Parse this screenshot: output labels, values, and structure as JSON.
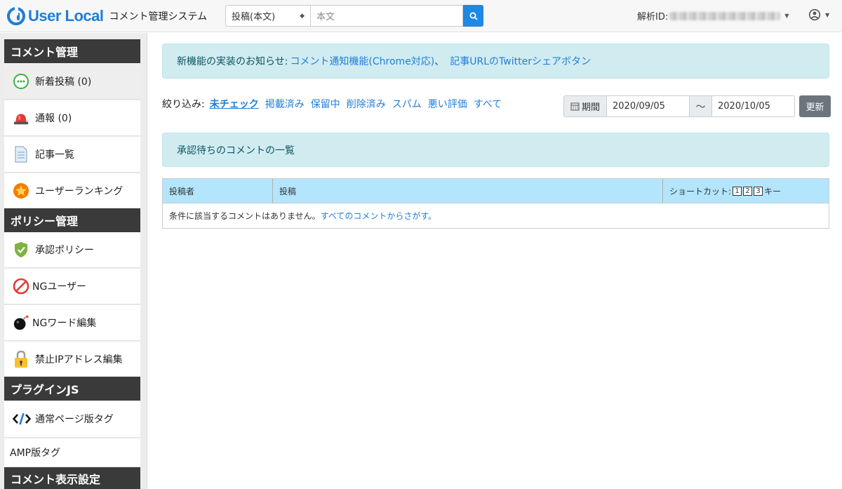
{
  "header": {
    "brand": "User Local",
    "subtitle": "コメント管理システム",
    "search_type": "投稿(本文)",
    "search_placeholder": "本文",
    "analysis_id_label": "解析ID:"
  },
  "sidebar": {
    "sections": [
      {
        "title": "コメント管理",
        "items": [
          {
            "label": "新着投稿 (0)",
            "icon": "chat-bubble-icon"
          },
          {
            "label": "通報 (0)",
            "icon": "alarm-light-icon"
          },
          {
            "label": "記事一覧",
            "icon": "document-icon"
          },
          {
            "label": "ユーザーランキング",
            "icon": "star-badge-icon"
          }
        ]
      },
      {
        "title": "ポリシー管理",
        "items": [
          {
            "label": "承認ポリシー",
            "icon": "shield-check-icon"
          },
          {
            "label": "NGユーザー",
            "icon": "prohibited-icon"
          },
          {
            "label": "NGワード編集",
            "icon": "bomb-icon"
          },
          {
            "label": "禁止IPアドレス編集",
            "icon": "lock-icon"
          }
        ]
      },
      {
        "title": "プラグインJS",
        "items": [
          {
            "label": "通常ページ版タグ",
            "icon": "code-icon"
          },
          {
            "label": "AMP版タグ",
            "icon": ""
          }
        ]
      },
      {
        "title": "コメント表示設定",
        "items": []
      }
    ]
  },
  "notice": {
    "prefix": "新機能の実装のお知らせ:",
    "link1": "コメント通知機能(Chrome対応)",
    "separator": "、",
    "link2": "記事URLのTwitterシェアボタン"
  },
  "filter": {
    "label": "絞り込み:",
    "options": [
      "未チェック",
      "掲載済み",
      "保留中",
      "削除済み",
      "スパム",
      "悪い評価",
      "すべて"
    ],
    "active": "未チェック"
  },
  "date_range": {
    "label": "期間",
    "from": "2020/09/05",
    "tilde": "〜",
    "to": "2020/10/05",
    "update_label": "更新"
  },
  "list_title": "承認待ちのコメントの一覧",
  "table": {
    "columns": [
      "投稿者",
      "投稿",
      "ショートカット:"
    ],
    "shortcut_keys": [
      "1",
      "2",
      "3"
    ],
    "shortcut_suffix": "キー",
    "empty_message": "条件に該当するコメントはありません。",
    "empty_link": "すべてのコメントからさがす。"
  },
  "colors": {
    "brand": "#1e7ed8",
    "sidebar_header": "#3a3a3a",
    "alert_bg": "#d1ecf1",
    "table_header_bg": "#b3e5fc",
    "update_button": "#6c757d"
  }
}
